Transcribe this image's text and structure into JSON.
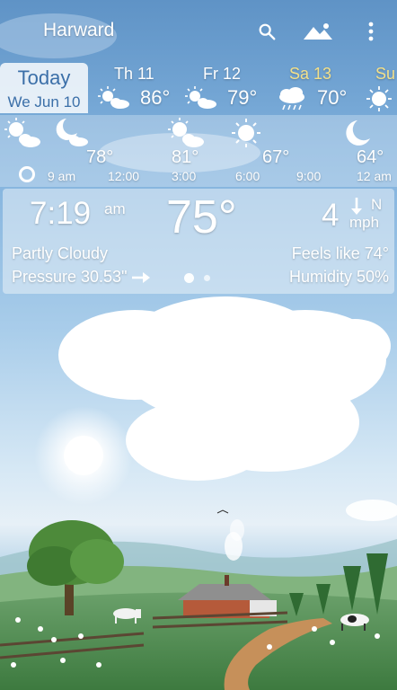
{
  "header": {
    "location": "Harward",
    "search_icon": "search-icon",
    "photo_icon": "landscape-photo-icon",
    "menu_icon": "more-vert-icon"
  },
  "daily": {
    "today": {
      "label": "Today",
      "date": "We Jun 10"
    },
    "days": [
      {
        "name": "Th 11",
        "temp": "86°",
        "icon": "partly-cloudy-icon",
        "highlight": false
      },
      {
        "name": "Fr 12",
        "temp": "79°",
        "icon": "partly-cloudy-icon",
        "highlight": false
      },
      {
        "name": "Sa 13",
        "temp": "70°",
        "icon": "rain-icon",
        "highlight": true
      },
      {
        "name": "Su",
        "icon": "sun-icon",
        "highlight": true
      }
    ]
  },
  "hourly": [
    {
      "time": "9 am",
      "temp": "",
      "icon": "partly-cloudy-icon",
      "current_marker": true
    },
    {
      "time": "12:00",
      "temp": "78°",
      "icon": "moon-cloud-icon"
    },
    {
      "time": "3:00",
      "temp": "81°",
      "icon": "partly-cloudy-icon"
    },
    {
      "time": "6:00",
      "temp": "67°",
      "icon": "sun-icon"
    },
    {
      "time": "9:00",
      "temp": "",
      "icon": ""
    },
    {
      "time": "12 am",
      "temp": "64°",
      "icon": "moon-icon"
    }
  ],
  "current": {
    "time": "7:19",
    "ampm": "am",
    "temp": "75°",
    "wind_speed": "4",
    "wind_dir": "N",
    "wind_unit": "mph",
    "condition": "Partly Cloudy",
    "feels_like": "Feels like 74°",
    "pressure": "Pressure 30.53\"",
    "humidity": "Humidity 50%",
    "page_count": 2,
    "active_page": 1
  },
  "colors": {
    "today_text": "#3b6fa8",
    "highlight_day": "#f3e08a",
    "sky_top": "#5f93c6"
  }
}
